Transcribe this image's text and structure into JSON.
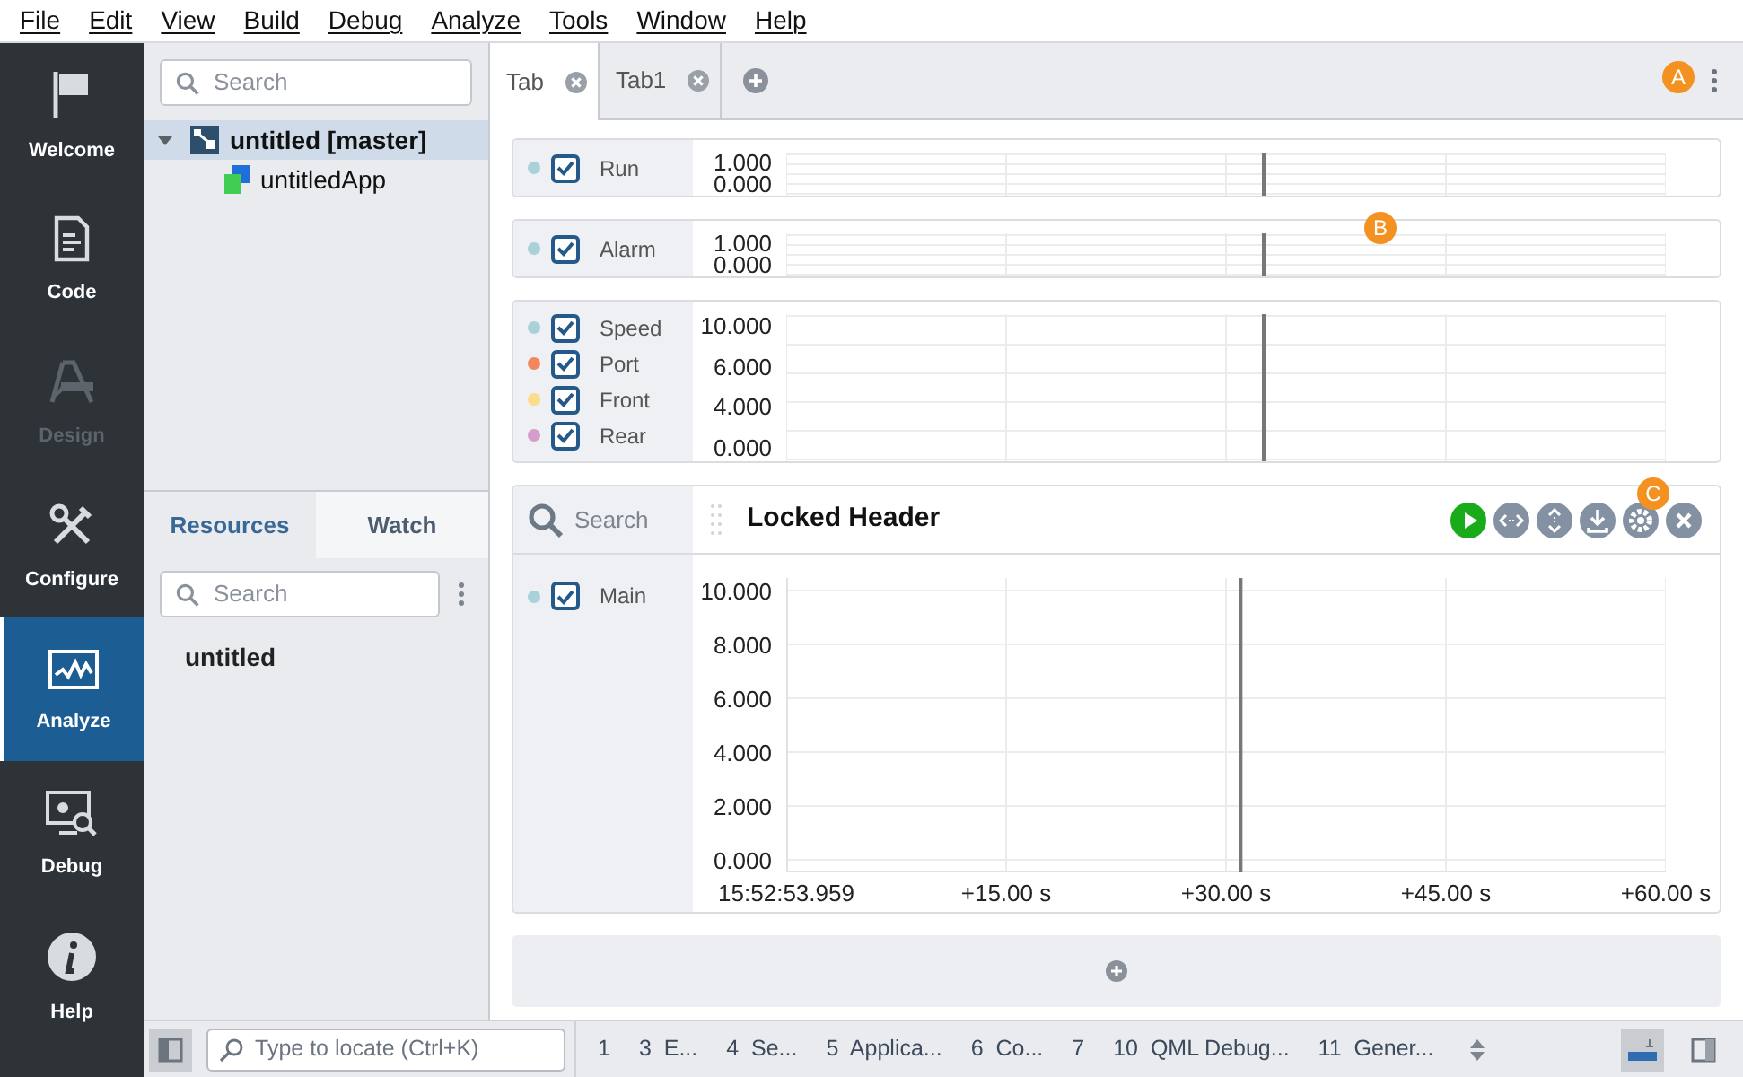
{
  "menu": [
    "File",
    "Edit",
    "View",
    "Build",
    "Debug",
    "Analyze",
    "Tools",
    "Window",
    "Help"
  ],
  "mode_bar": [
    {
      "label": "Welcome",
      "selected": false,
      "disabled": false
    },
    {
      "label": "Code",
      "selected": false,
      "disabled": false
    },
    {
      "label": "Design",
      "selected": false,
      "disabled": true
    },
    {
      "label": "Configure",
      "selected": false,
      "disabled": false
    },
    {
      "label": "Analyze",
      "selected": true,
      "disabled": false
    },
    {
      "label": "Debug",
      "selected": false,
      "disabled": false
    },
    {
      "label": "Help",
      "selected": false,
      "disabled": false
    }
  ],
  "project_search": {
    "placeholder": "Search"
  },
  "project_tree": [
    {
      "label": "untitled [master]",
      "expanded": true,
      "selected": true,
      "children": [
        {
          "label": "untitledApp",
          "selected": false
        }
      ]
    }
  ],
  "lower_tabs": [
    {
      "label": "Resources",
      "selected": true
    },
    {
      "label": "Watch",
      "selected": false
    }
  ],
  "resource_search": {
    "placeholder": "Search"
  },
  "resources": [
    {
      "label": "untitled"
    }
  ],
  "tabs": [
    {
      "label": "Tab",
      "selected": true
    },
    {
      "label": "Tab1",
      "selected": false
    }
  ],
  "markers": [
    "A",
    "B",
    "C"
  ],
  "panels": [
    {
      "signals": [
        {
          "name": "Run",
          "checked": true,
          "color": "#a9d1d9"
        }
      ],
      "y_labels": [
        "1.000",
        "0.000"
      ]
    },
    {
      "signals": [
        {
          "name": "Alarm",
          "checked": true,
          "color": "#a9d1d9"
        }
      ],
      "y_labels": [
        "1.000",
        "0.000"
      ]
    },
    {
      "signals": [
        {
          "name": "Speed",
          "checked": true,
          "color": "#a9d1d9"
        },
        {
          "name": "Port",
          "checked": true,
          "color": "#f2875f"
        },
        {
          "name": "Front",
          "checked": true,
          "color": "#fbdc8a"
        },
        {
          "name": "Rear",
          "checked": true,
          "color": "#d59ccc"
        }
      ],
      "y_labels": [
        "10.000",
        "6.000",
        "4.000",
        "0.000"
      ]
    }
  ],
  "locked_panel": {
    "search_placeholder": "Search",
    "title": "Locked Header",
    "signals": [
      {
        "name": "Main",
        "checked": true,
        "color": "#a9d1d9"
      }
    ],
    "chart_data": {
      "type": "line",
      "grid": true,
      "ref_lines": [
        {
          "axis": "x",
          "value": 31
        }
      ],
      "xlim": [
        0,
        60
      ],
      "ylim": [
        0,
        10
      ],
      "yticks": [
        {
          "value": 10,
          "label": "10.000"
        },
        {
          "value": 8,
          "label": "8.000"
        },
        {
          "value": 6,
          "label": "6.000"
        },
        {
          "value": 4,
          "label": "4.000"
        },
        {
          "value": 2,
          "label": "2.000"
        },
        {
          "value": 0,
          "label": "0.000"
        }
      ],
      "xticks": [
        {
          "value": 0,
          "label": "15:52:53.959"
        },
        {
          "value": 15,
          "label": "+15.00 s"
        },
        {
          "value": 30,
          "label": "+30.00 s"
        },
        {
          "value": 45,
          "label": "+45.00 s"
        },
        {
          "value": 60,
          "label": "+60.00 s"
        }
      ]
    }
  },
  "status_bar": {
    "locate_placeholder": "Type to locate (Ctrl+K)",
    "panes": [
      {
        "number": "1"
      },
      {
        "number": "3",
        "label": "E..."
      },
      {
        "number": "4",
        "label": "Se..."
      },
      {
        "number": "5",
        "label": "Applica..."
      },
      {
        "number": "6",
        "label": "Co..."
      },
      {
        "number": "7"
      },
      {
        "number": "10",
        "label": "QML Debug..."
      },
      {
        "number": "11",
        "label": "Gener..."
      }
    ]
  }
}
